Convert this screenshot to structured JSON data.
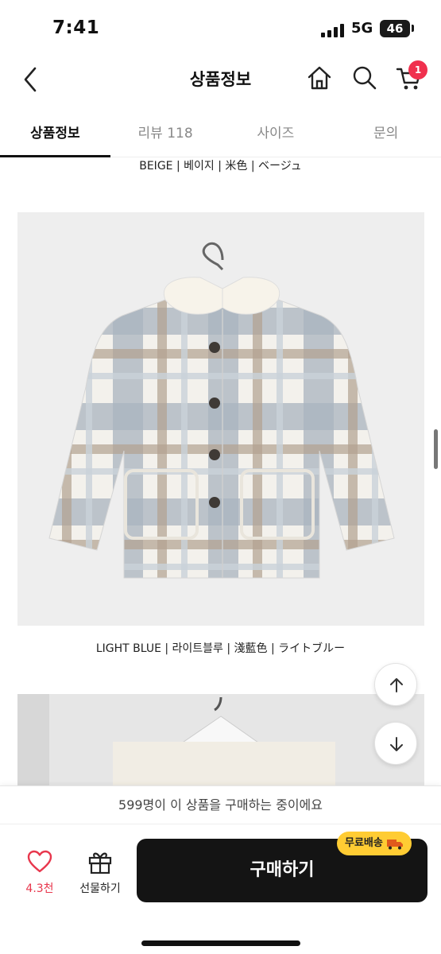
{
  "status": {
    "time": "7:41",
    "network": "5G",
    "battery": "46",
    "battery_level": 0.46
  },
  "header": {
    "title": "상품정보",
    "cart_count": "1"
  },
  "tabs": [
    {
      "label": "상품정보",
      "active": true
    },
    {
      "label": "리뷰 118",
      "active": false
    },
    {
      "label": "사이즈",
      "active": false
    },
    {
      "label": "문의",
      "active": false
    }
  ],
  "content": {
    "caption_beige": "BEIGE | 베이지 | 米色 | ベージュ",
    "caption_light_blue": "LIGHT BLUE | 라이트블루 | 淺藍色 | ライトブルー"
  },
  "bottom": {
    "promo": "599명이 이 상품을 구매하는 중이에요",
    "wish_count": "4.3천",
    "gift_label": "선물하기",
    "buy_label": "구매하기",
    "shipping_badge": "무료배송"
  },
  "colors": {
    "accent": "#f0304e",
    "wish": "#e8374d",
    "buy_button": "#141414",
    "shipping_badge": "#ffcc33"
  },
  "icons": [
    "back-icon",
    "home-icon",
    "search-icon",
    "cart-icon",
    "arrow-up-icon",
    "arrow-down-icon",
    "heart-icon",
    "gift-icon",
    "truck-icon"
  ]
}
